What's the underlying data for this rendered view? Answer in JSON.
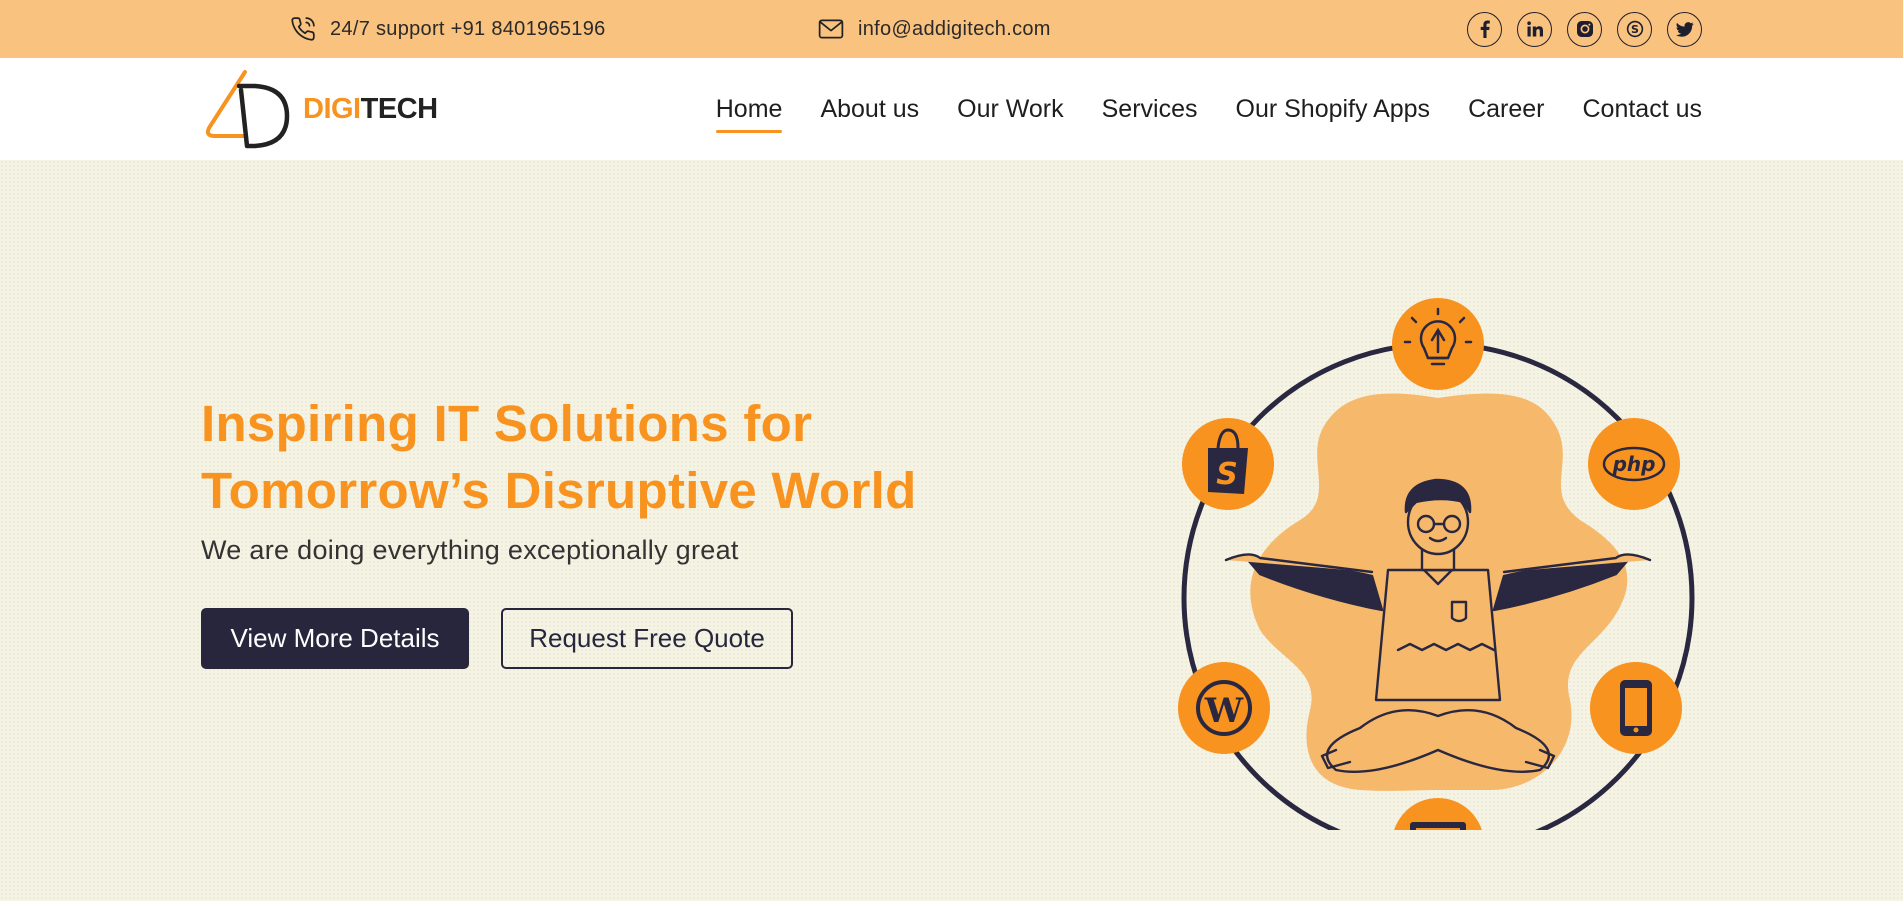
{
  "topbar": {
    "phone_text": "24/7 support +91 8401965196",
    "email_text": "info@addigitech.com",
    "social_icons": [
      "facebook-icon",
      "linkedin-icon",
      "instagram-icon",
      "skype-icon",
      "twitter-icon"
    ]
  },
  "logo": {
    "brand_digi": "DIGI",
    "brand_tech": "TECH"
  },
  "nav": {
    "items": [
      "Home",
      "About us",
      "Our Work",
      "Services",
      "Our Shopify Apps",
      "Career",
      "Contact us"
    ],
    "active": "Home"
  },
  "hero": {
    "title_line1": "Inspiring IT Solutions for",
    "title_line2": "Tomorrow’s Disruptive World",
    "subtitle": "We are doing everything exceptionally great",
    "primary_button": "View More Details",
    "secondary_button": "Request Free Quote",
    "orbit_icons": [
      "idea-pen-icon",
      "php-icon",
      "mobile-icon",
      "desktop-icon",
      "wordpress-icon",
      "shopify-icon"
    ],
    "php_badge": "php"
  },
  "colors": {
    "accent": "#f7931e",
    "topbar_bg": "#f9c27f",
    "dark": "#28263d",
    "hero_bg": "#f5f3e4"
  }
}
